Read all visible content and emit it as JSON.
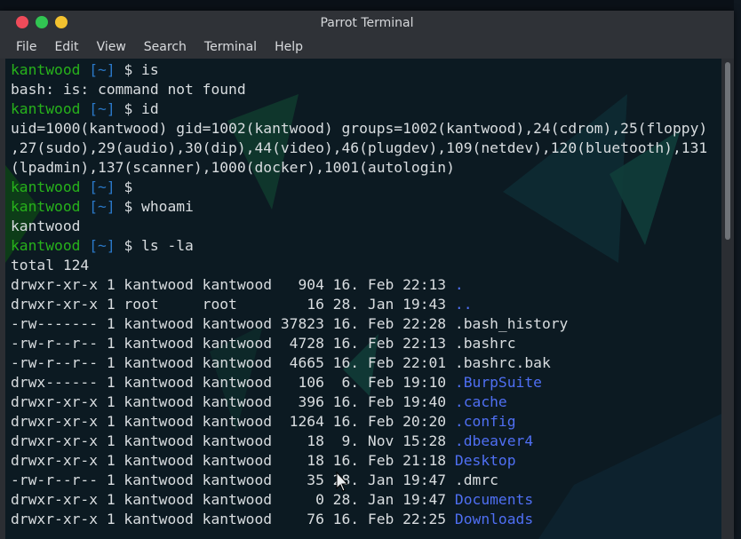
{
  "window": {
    "title": "Parrot Terminal"
  },
  "menu": [
    "File",
    "Edit",
    "View",
    "Search",
    "Terminal",
    "Help"
  ],
  "colors": {
    "prompt_user": "#27b21b",
    "prompt_bracket": "#2a78c8",
    "directory_entry": "#4f6ff3",
    "text": "#d9dde0"
  },
  "prompt": {
    "user": "kantwood",
    "dir": "~",
    "symbol": "$"
  },
  "session": [
    {
      "type": "prompt",
      "cmd": "is"
    },
    {
      "type": "out",
      "text": "bash: is: command not found"
    },
    {
      "type": "prompt",
      "cmd": "id"
    },
    {
      "type": "out",
      "text": "uid=1000(kantwood) gid=1002(kantwood) groups=1002(kantwood),24(cdrom),25(floppy)"
    },
    {
      "type": "out",
      "text": ",27(sudo),29(audio),30(dip),44(video),46(plugdev),109(netdev),120(bluetooth),131"
    },
    {
      "type": "out",
      "text": "(lpadmin),137(scanner),1000(docker),1001(autologin)"
    },
    {
      "type": "prompt",
      "cmd": ""
    },
    {
      "type": "prompt",
      "cmd": "whoami"
    },
    {
      "type": "out",
      "text": "kantwood"
    },
    {
      "type": "prompt",
      "cmd": "ls -la"
    },
    {
      "type": "out",
      "text": "total 124"
    },
    {
      "type": "ls",
      "meta": "drwxr-xr-x 1 kantwood kantwood   904 16. Feb 22:13 ",
      "name": ".",
      "is_dir": true
    },
    {
      "type": "ls",
      "meta": "drwxr-xr-x 1 root     root        16 28. Jan 19:43 ",
      "name": "..",
      "is_dir": true
    },
    {
      "type": "ls",
      "meta": "-rw------- 1 kantwood kantwood 37823 16. Feb 22:28 ",
      "name": ".bash_history",
      "is_dir": false
    },
    {
      "type": "ls",
      "meta": "-rw-r--r-- 1 kantwood kantwood  4728 16. Feb 22:13 ",
      "name": ".bashrc",
      "is_dir": false
    },
    {
      "type": "ls",
      "meta": "-rw-r--r-- 1 kantwood kantwood  4665 16. Feb 22:01 ",
      "name": ".bashrc.bak",
      "is_dir": false
    },
    {
      "type": "ls",
      "meta": "drwx------ 1 kantwood kantwood   106  6. Feb 19:10 ",
      "name": ".BurpSuite",
      "is_dir": true
    },
    {
      "type": "ls",
      "meta": "drwxr-xr-x 1 kantwood kantwood   396 16. Feb 19:40 ",
      "name": ".cache",
      "is_dir": true
    },
    {
      "type": "ls",
      "meta": "drwxr-xr-x 1 kantwood kantwood  1264 16. Feb 20:20 ",
      "name": ".config",
      "is_dir": true
    },
    {
      "type": "ls",
      "meta": "drwxr-xr-x 1 kantwood kantwood    18  9. Nov 15:28 ",
      "name": ".dbeaver4",
      "is_dir": true
    },
    {
      "type": "ls",
      "meta": "drwxr-xr-x 1 kantwood kantwood    18 16. Feb 21:18 ",
      "name": "Desktop",
      "is_dir": true
    },
    {
      "type": "ls",
      "meta": "-rw-r--r-- 1 kantwood kantwood    35 28. Jan 19:47 ",
      "name": ".dmrc",
      "is_dir": false
    },
    {
      "type": "ls",
      "meta": "drwxr-xr-x 1 kantwood kantwood     0 28. Jan 19:47 ",
      "name": "Documents",
      "is_dir": true
    },
    {
      "type": "ls",
      "meta": "drwxr-xr-x 1 kantwood kantwood    76 16. Feb 22:25 ",
      "name": "Downloads",
      "is_dir": true
    }
  ]
}
